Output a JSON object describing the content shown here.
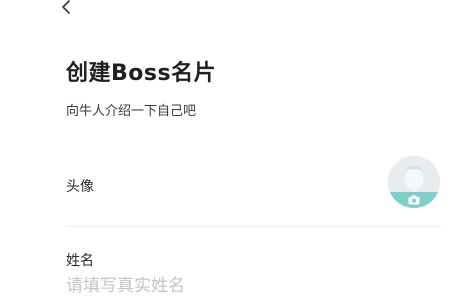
{
  "header": {
    "back_icon": "chevron-left-icon"
  },
  "main": {
    "title": "创建Boss名片",
    "subtitle": "向牛人介绍一下自己吧"
  },
  "avatar_field": {
    "label": "头像",
    "avatar_icon": "default-avatar-icon",
    "camera_icon": "camera-icon",
    "camera_band_color": "#7fcfc8"
  },
  "name_field": {
    "label": "姓名",
    "value": "",
    "placeholder": "请填写真实姓名"
  }
}
